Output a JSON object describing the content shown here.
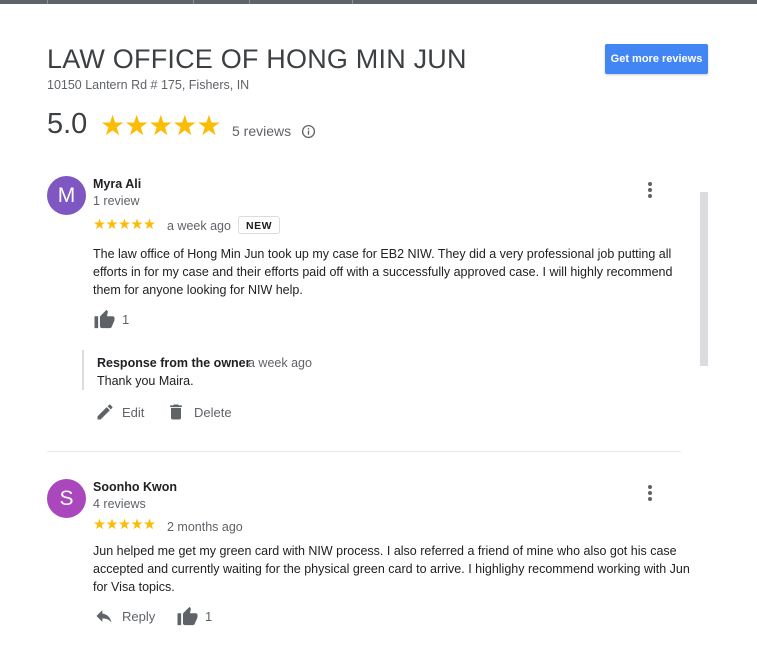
{
  "business": {
    "name": "LAW OFFICE OF HONG MIN JUN",
    "address": "10150 Lantern Rd # 175, Fishers, IN"
  },
  "actions": {
    "get_more_reviews": "Get more reviews"
  },
  "summary": {
    "rating": "5.0",
    "stars": "★★★★★",
    "review_count": "5 reviews"
  },
  "colors": {
    "accent": "#4285f4",
    "star": "#fbbc04",
    "avatar_1": "#7e57c2",
    "avatar_2": "#ab47bc"
  },
  "reviews": [
    {
      "avatar_letter": "M",
      "name": "Myra Ali",
      "reviewer_reviews": "1 review",
      "stars": "★★★★★",
      "time": "a week ago",
      "badge": "NEW",
      "text": "The law office of Hong Min Jun took up my case for EB2 NIW. They did a very professional job putting all efforts in for my case and their efforts paid off with a successfully approved case. I will highly recommend them for anyone looking for NIW help.",
      "likes": "1",
      "owner_response": {
        "label": "Response from the owner",
        "time": "a week ago",
        "text": "Thank you Maira."
      },
      "edit_label": "Edit",
      "delete_label": "Delete"
    },
    {
      "avatar_letter": "S",
      "name": "Soonho Kwon",
      "reviewer_reviews": "4 reviews",
      "stars": "★★★★★",
      "time": "2 months ago",
      "text": "Jun helped me get my green card with NIW process. I also referred a friend of mine who also got his case accepted and currently waiting for the physical green card to arrive. I highlighy recommend working with Jun for Visa topics.",
      "reply_label": "Reply",
      "likes": "1"
    }
  ]
}
